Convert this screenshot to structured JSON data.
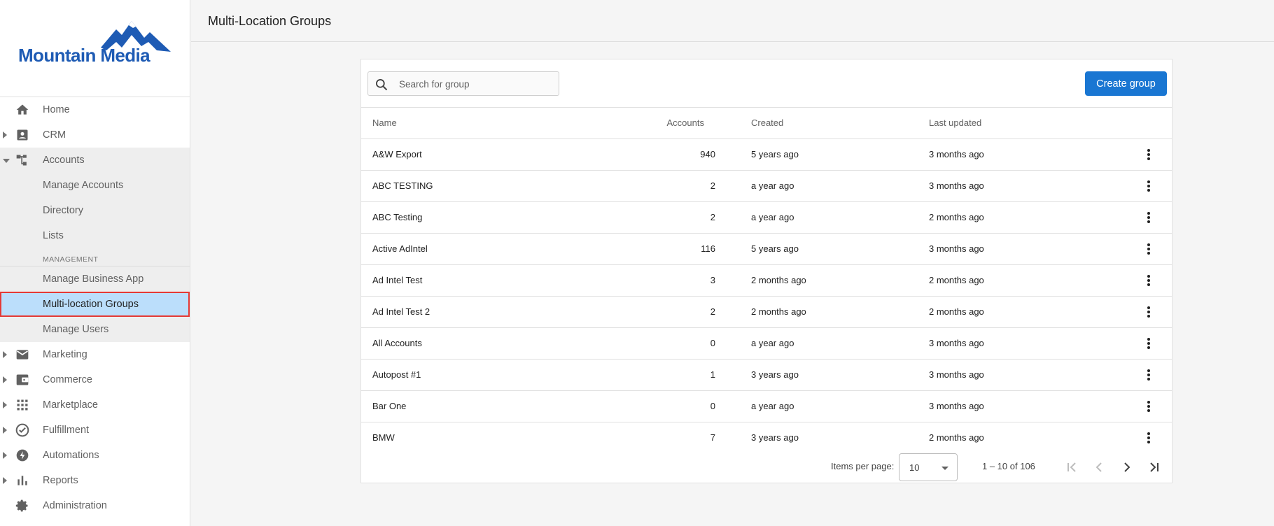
{
  "brand": {
    "name": "Mountain Media",
    "color": "#1e5bb4"
  },
  "sidebar": {
    "items": [
      {
        "label": "Home",
        "icon": "home-icon"
      },
      {
        "label": "CRM",
        "icon": "contact-card-icon"
      },
      {
        "label": "Accounts",
        "icon": "hierarchy-icon",
        "children": [
          "Manage Accounts",
          "Directory",
          "Lists"
        ],
        "section": "MANAGEMENT",
        "section_children": [
          "Manage Business App",
          "Multi-location Groups",
          "Manage Users"
        ],
        "active": "Multi-location Groups"
      },
      {
        "label": "Marketing",
        "icon": "mail-icon"
      },
      {
        "label": "Commerce",
        "icon": "wallet-icon"
      },
      {
        "label": "Marketplace",
        "icon": "grid-icon"
      },
      {
        "label": "Fulfillment",
        "icon": "check-circle-icon"
      },
      {
        "label": "Automations",
        "icon": "bolt-icon"
      },
      {
        "label": "Reports",
        "icon": "bar-chart-icon"
      },
      {
        "label": "Administration",
        "icon": "gear-icon"
      }
    ]
  },
  "header": {
    "title": "Multi-Location Groups"
  },
  "toolbar": {
    "search_placeholder": "Search for group",
    "create_label": "Create group"
  },
  "table": {
    "columns": [
      "Name",
      "Accounts",
      "Created",
      "Last updated"
    ],
    "rows": [
      {
        "name": "A&W Export",
        "accounts": "940",
        "created": "5 years ago",
        "updated": "3 months ago"
      },
      {
        "name": "ABC TESTING",
        "accounts": "2",
        "created": "a year ago",
        "updated": "3 months ago"
      },
      {
        "name": "ABC Testing",
        "accounts": "2",
        "created": "a year ago",
        "updated": "2 months ago"
      },
      {
        "name": "Active AdIntel",
        "accounts": "116",
        "created": "5 years ago",
        "updated": "3 months ago"
      },
      {
        "name": "Ad Intel Test",
        "accounts": "3",
        "created": "2 months ago",
        "updated": "2 months ago"
      },
      {
        "name": "Ad Intel Test 2",
        "accounts": "2",
        "created": "2 months ago",
        "updated": "2 months ago"
      },
      {
        "name": "All Accounts",
        "accounts": "0",
        "created": "a year ago",
        "updated": "3 months ago"
      },
      {
        "name": "Autopost #1",
        "accounts": "1",
        "created": "3 years ago",
        "updated": "3 months ago"
      },
      {
        "name": "Bar One",
        "accounts": "0",
        "created": "a year ago",
        "updated": "3 months ago"
      },
      {
        "name": "BMW",
        "accounts": "7",
        "created": "3 years ago",
        "updated": "2 months ago"
      }
    ]
  },
  "paginator": {
    "label": "Items per page:",
    "page_size": "10",
    "range": "1 – 10 of 106"
  },
  "colors": {
    "accent": "#1976d2",
    "active_bg": "#bbdefb",
    "highlight_border": "#e53935"
  }
}
